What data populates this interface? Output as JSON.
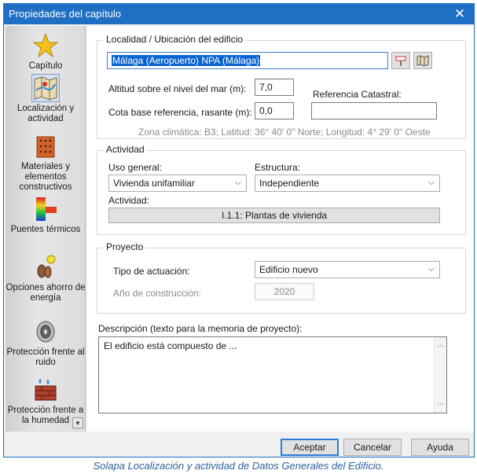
{
  "window": {
    "title": "Propiedades del capítulo"
  },
  "sidebar": {
    "items": [
      {
        "label": "Capítulo",
        "icon": "star-icon"
      },
      {
        "label": "Localización y actividad",
        "icon": "map-icon"
      },
      {
        "label": "Materiales y elementos constructivos",
        "icon": "brick-icon"
      },
      {
        "label": "Puentes térmicos",
        "icon": "thermal-bridge-icon"
      },
      {
        "label": "Opciones ahorro de energía",
        "icon": "energy-options-icon"
      },
      {
        "label": "Protección frente al ruido",
        "icon": "speaker-icon"
      },
      {
        "label": "Protección frente a la humedad",
        "icon": "humidity-icon"
      }
    ],
    "selected_index": 1
  },
  "location": {
    "group_label": "Localidad / Ubicación del edificio",
    "value": "Málaga (Aeropuerto) NPA (Málaga)",
    "altitude_label": "Altitud sobre el nivel del mar (m):",
    "altitude_value": "7,0",
    "base_label": "Cota base referencia, rasante (m):",
    "base_value": "0,0",
    "cadastral_label": "Referencia Catastral:",
    "cadastral_value": "",
    "climate_info": "Zona climática: B3; Latitud: 36° 40' 0\" Norte; Longitud: 4° 29' 0\" Oeste"
  },
  "activity": {
    "group_label": "Actividad",
    "general_use_label": "Uso general:",
    "general_use_value": "Vivienda unifamiliar",
    "structure_label": "Estructura:",
    "structure_value": "Independiente",
    "activity_label": "Actividad:",
    "activity_button": "I.1.1: Plantas de vivienda"
  },
  "project": {
    "group_label": "Proyecto",
    "action_type_label": "Tipo de actuación:",
    "action_type_value": "Edificio nuevo",
    "year_label": "Año de construcción:",
    "year_value": "2020"
  },
  "description": {
    "label": "Descripción (texto para la memoria de proyecto):",
    "value": "El edificio está compuesto de ..."
  },
  "footer": {
    "accept": "Aceptar",
    "cancel": "Cancelar",
    "help": "Ayuda"
  },
  "caption": "Solapa Localización y actividad de Datos Generales del Edificio."
}
